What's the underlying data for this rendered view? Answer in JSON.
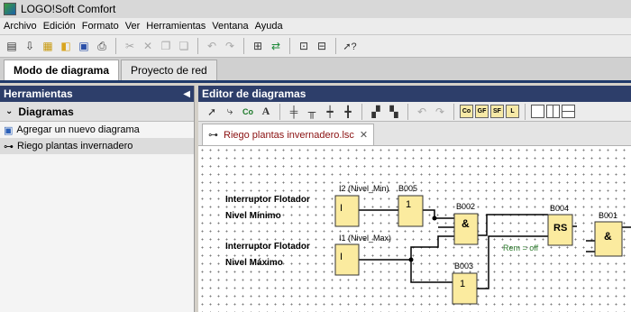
{
  "window": {
    "title": "LOGO!Soft Comfort"
  },
  "menu": [
    "Archivo",
    "Edición",
    "Formato",
    "Ver",
    "Herramientas",
    "Ventana",
    "Ayuda"
  ],
  "main_tabs": [
    {
      "label": "Modo de diagrama",
      "active": true
    },
    {
      "label": "Proyecto de red",
      "active": false
    }
  ],
  "tools_panel": {
    "title": "Herramientas",
    "section": "Diagramas",
    "items": [
      "Agregar un nuevo diagrama",
      "Riego plantas invernadero"
    ]
  },
  "editor": {
    "title": "Editor de diagramas",
    "file_tab": "Riego plantas invernadero.lsc",
    "constant_buttons": [
      "Co",
      "GF",
      "SF",
      "L"
    ]
  },
  "diagram": {
    "labels": {
      "sensor1_line1": "Interruptor Flotador",
      "sensor1_line2": "Nivel Mínimo",
      "sensor2_line1": "Interruptor Flotador",
      "sensor2_line2": "Nivel Máximo",
      "i2": "I2 (Nivel_Min)",
      "i1": "I1 (Nivel_Max)",
      "b005": "B005",
      "b002": "B002",
      "b003": "B003",
      "b004": "B004",
      "b001": "B001",
      "rem": "Rem = off"
    },
    "blocks": {
      "i2": "I",
      "i1": "I",
      "b005": "1",
      "b002": "&",
      "b003": "1",
      "b004": "RS",
      "b001": "&"
    }
  }
}
